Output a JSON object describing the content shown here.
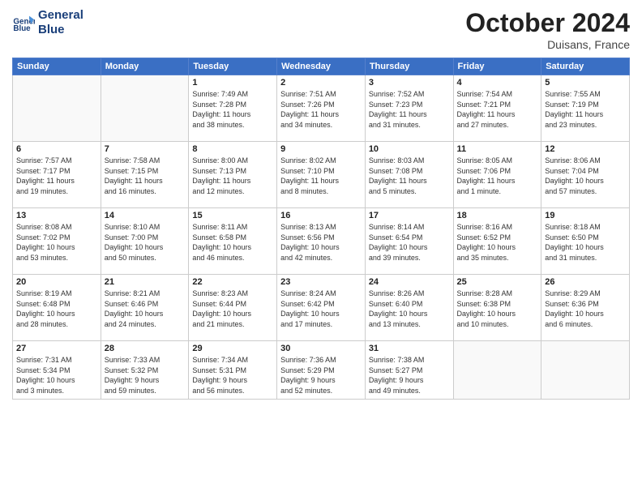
{
  "header": {
    "logo_line1": "General",
    "logo_line2": "Blue",
    "month": "October 2024",
    "location": "Duisans, France"
  },
  "weekdays": [
    "Sunday",
    "Monday",
    "Tuesday",
    "Wednesday",
    "Thursday",
    "Friday",
    "Saturday"
  ],
  "weeks": [
    [
      {
        "day": "",
        "info": ""
      },
      {
        "day": "",
        "info": ""
      },
      {
        "day": "1",
        "info": "Sunrise: 7:49 AM\nSunset: 7:28 PM\nDaylight: 11 hours\nand 38 minutes."
      },
      {
        "day": "2",
        "info": "Sunrise: 7:51 AM\nSunset: 7:26 PM\nDaylight: 11 hours\nand 34 minutes."
      },
      {
        "day": "3",
        "info": "Sunrise: 7:52 AM\nSunset: 7:23 PM\nDaylight: 11 hours\nand 31 minutes."
      },
      {
        "day": "4",
        "info": "Sunrise: 7:54 AM\nSunset: 7:21 PM\nDaylight: 11 hours\nand 27 minutes."
      },
      {
        "day": "5",
        "info": "Sunrise: 7:55 AM\nSunset: 7:19 PM\nDaylight: 11 hours\nand 23 minutes."
      }
    ],
    [
      {
        "day": "6",
        "info": "Sunrise: 7:57 AM\nSunset: 7:17 PM\nDaylight: 11 hours\nand 19 minutes."
      },
      {
        "day": "7",
        "info": "Sunrise: 7:58 AM\nSunset: 7:15 PM\nDaylight: 11 hours\nand 16 minutes."
      },
      {
        "day": "8",
        "info": "Sunrise: 8:00 AM\nSunset: 7:13 PM\nDaylight: 11 hours\nand 12 minutes."
      },
      {
        "day": "9",
        "info": "Sunrise: 8:02 AM\nSunset: 7:10 PM\nDaylight: 11 hours\nand 8 minutes."
      },
      {
        "day": "10",
        "info": "Sunrise: 8:03 AM\nSunset: 7:08 PM\nDaylight: 11 hours\nand 5 minutes."
      },
      {
        "day": "11",
        "info": "Sunrise: 8:05 AM\nSunset: 7:06 PM\nDaylight: 11 hours\nand 1 minute."
      },
      {
        "day": "12",
        "info": "Sunrise: 8:06 AM\nSunset: 7:04 PM\nDaylight: 10 hours\nand 57 minutes."
      }
    ],
    [
      {
        "day": "13",
        "info": "Sunrise: 8:08 AM\nSunset: 7:02 PM\nDaylight: 10 hours\nand 53 minutes."
      },
      {
        "day": "14",
        "info": "Sunrise: 8:10 AM\nSunset: 7:00 PM\nDaylight: 10 hours\nand 50 minutes."
      },
      {
        "day": "15",
        "info": "Sunrise: 8:11 AM\nSunset: 6:58 PM\nDaylight: 10 hours\nand 46 minutes."
      },
      {
        "day": "16",
        "info": "Sunrise: 8:13 AM\nSunset: 6:56 PM\nDaylight: 10 hours\nand 42 minutes."
      },
      {
        "day": "17",
        "info": "Sunrise: 8:14 AM\nSunset: 6:54 PM\nDaylight: 10 hours\nand 39 minutes."
      },
      {
        "day": "18",
        "info": "Sunrise: 8:16 AM\nSunset: 6:52 PM\nDaylight: 10 hours\nand 35 minutes."
      },
      {
        "day": "19",
        "info": "Sunrise: 8:18 AM\nSunset: 6:50 PM\nDaylight: 10 hours\nand 31 minutes."
      }
    ],
    [
      {
        "day": "20",
        "info": "Sunrise: 8:19 AM\nSunset: 6:48 PM\nDaylight: 10 hours\nand 28 minutes."
      },
      {
        "day": "21",
        "info": "Sunrise: 8:21 AM\nSunset: 6:46 PM\nDaylight: 10 hours\nand 24 minutes."
      },
      {
        "day": "22",
        "info": "Sunrise: 8:23 AM\nSunset: 6:44 PM\nDaylight: 10 hours\nand 21 minutes."
      },
      {
        "day": "23",
        "info": "Sunrise: 8:24 AM\nSunset: 6:42 PM\nDaylight: 10 hours\nand 17 minutes."
      },
      {
        "day": "24",
        "info": "Sunrise: 8:26 AM\nSunset: 6:40 PM\nDaylight: 10 hours\nand 13 minutes."
      },
      {
        "day": "25",
        "info": "Sunrise: 8:28 AM\nSunset: 6:38 PM\nDaylight: 10 hours\nand 10 minutes."
      },
      {
        "day": "26",
        "info": "Sunrise: 8:29 AM\nSunset: 6:36 PM\nDaylight: 10 hours\nand 6 minutes."
      }
    ],
    [
      {
        "day": "27",
        "info": "Sunrise: 7:31 AM\nSunset: 5:34 PM\nDaylight: 10 hours\nand 3 minutes."
      },
      {
        "day": "28",
        "info": "Sunrise: 7:33 AM\nSunset: 5:32 PM\nDaylight: 9 hours\nand 59 minutes."
      },
      {
        "day": "29",
        "info": "Sunrise: 7:34 AM\nSunset: 5:31 PM\nDaylight: 9 hours\nand 56 minutes."
      },
      {
        "day": "30",
        "info": "Sunrise: 7:36 AM\nSunset: 5:29 PM\nDaylight: 9 hours\nand 52 minutes."
      },
      {
        "day": "31",
        "info": "Sunrise: 7:38 AM\nSunset: 5:27 PM\nDaylight: 9 hours\nand 49 minutes."
      },
      {
        "day": "",
        "info": ""
      },
      {
        "day": "",
        "info": ""
      }
    ]
  ]
}
